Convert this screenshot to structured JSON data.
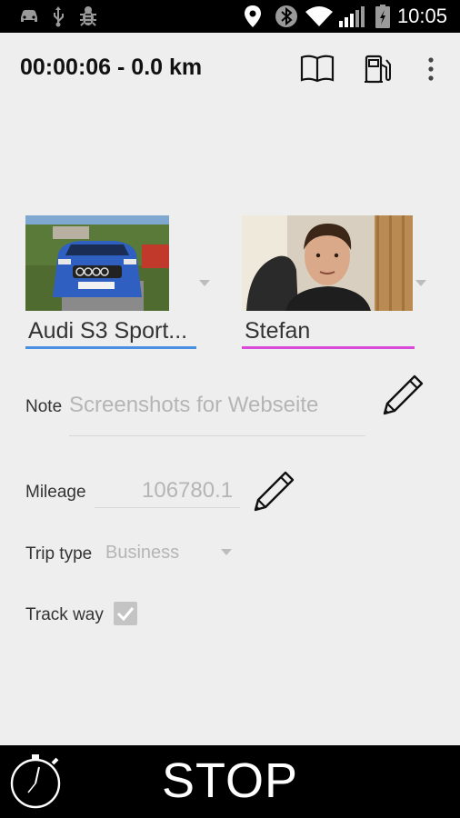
{
  "status_bar": {
    "time": "10:05",
    "icons": [
      "car-icon",
      "usb-icon",
      "bug-icon",
      "location-icon",
      "bluetooth-icon",
      "wifi-icon",
      "signal-icon",
      "battery-charging-icon"
    ]
  },
  "toolbar": {
    "title": "00:00:06 - 0.0 km",
    "actions": [
      "logbook-icon",
      "fuel-icon",
      "overflow-menu-icon"
    ]
  },
  "vehicle": {
    "name": "Audi S3 Sport...",
    "accent": "#4a90e2"
  },
  "driver": {
    "name": "Stefan",
    "accent": "#d94ad9"
  },
  "note": {
    "label": "Note",
    "value": "Screenshots for Webseite"
  },
  "mileage": {
    "label": "Mileage",
    "value": "106780.1"
  },
  "trip_type": {
    "label": "Trip type",
    "value": "Business"
  },
  "track_way": {
    "label": "Track way",
    "checked": true
  },
  "bottom": {
    "stop_label": "STOP"
  }
}
